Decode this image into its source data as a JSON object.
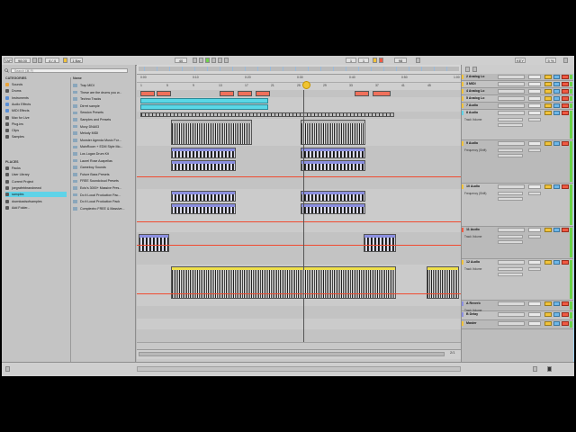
{
  "transport": {
    "tap_label": "TAP",
    "tempo": "98.00",
    "signature": "4 / 4",
    "metronome_label": "1 Bar",
    "position": "40",
    "loop_start": "1",
    "loop_end": "1",
    "loop_length": "98",
    "key_label": "KEY",
    "cpu": "5 %"
  },
  "browser": {
    "search_placeholder": "Search (⌘ F)",
    "categories_title": "CATEGORIES",
    "places_title": "PLACES",
    "categories": [
      {
        "label": "Sounds",
        "color": "#e8a33a"
      },
      {
        "label": "Drums",
        "color": "#5a5a5a"
      },
      {
        "label": "Instruments",
        "color": "#5a8fd6"
      },
      {
        "label": "Audio Effects",
        "color": "#5a8fd6"
      },
      {
        "label": "MIDI Effects",
        "color": "#5a8fd6"
      },
      {
        "label": "Max for Live",
        "color": "#5a5a5a"
      },
      {
        "label": "Plug-ins",
        "color": "#5a5a5a"
      },
      {
        "label": "Clips",
        "color": "#5a5a5a"
      },
      {
        "label": "Samples",
        "color": "#5a5a5a"
      }
    ],
    "places": [
      {
        "label": "Packs",
        "color": "#5a5a5a"
      },
      {
        "label": "User Library",
        "color": "#5a5a5a"
      },
      {
        "label": "Current Project",
        "color": "#5a5a5a"
      },
      {
        "label": "joegrafebbrandnewd",
        "color": "#5a5a5a"
      },
      {
        "label": "samples",
        "color": "#5a5a5a"
      },
      {
        "label": "downloadsofsamples",
        "color": "#5a5a5a"
      },
      {
        "label": "Add Folder...",
        "color": "#5a5a5a"
      }
    ],
    "files_title": "Name",
    "files": [
      "Trap MIDI",
      "These are the drums you w...",
      "Techno Tracks",
      "Dirrrrt sample",
      "Session Presets",
      "Samples and Presets",
      "Moxy DNA03",
      "Melody MIDI",
      "Monster Agenda Music For...",
      "MainRoom + EDM Style Mo...",
      "Los Logan Drum Kit",
      "Laurel Rose Acapellas",
      "Gameboy Sounds",
      "Future Bass Presets",
      "FREE Soundcloud Presets",
      "Ecto's 3000+ Massive Pres...",
      "Do it Local Production Pac...",
      "Do it Local Production Pack",
      "Complextro FREE & Massive..."
    ]
  },
  "mixer": {
    "tracks": [
      {
        "name": "2 Analog Lo",
        "color": "#f2c33a",
        "sub": "",
        "height": 8
      },
      {
        "name": "3 MIDI",
        "color": "#f2c33a",
        "sub": "",
        "height": 8
      },
      {
        "name": "4 Analog Lo",
        "color": "#f2c33a",
        "sub": "",
        "height": 8
      },
      {
        "name": "5 Analog Lo",
        "color": "#f2c33a",
        "sub": "",
        "height": 8
      },
      {
        "name": "7 Audio",
        "color": "#f2c33a",
        "sub": "",
        "height": 8
      },
      {
        "name": "8 Audio",
        "color": "#5fd3e8",
        "sub": "Track Volume",
        "height": 34
      },
      {
        "name": "9 Audio",
        "color": "#f2c33a",
        "sub": "Frequency (Shift)",
        "height": 48
      },
      {
        "name": "10 Audio",
        "color": "#f2c33a",
        "sub": "Frequency (Shift)",
        "height": 48
      },
      {
        "name": "11 Audio",
        "color": "#f05a43",
        "sub": "Track Volume",
        "height": 36
      },
      {
        "name": "12 Audio",
        "color": "#f2c33a",
        "sub": "Track Volume",
        "height": 46
      },
      {
        "name": "A Reverb",
        "color": "#8b8fe0",
        "sub": "Track Volume",
        "height": 12
      },
      {
        "name": "B Delay",
        "color": "#8b8fe0",
        "sub": "",
        "height": 10
      },
      {
        "name": "Master",
        "color": "#f2c33a",
        "sub": "",
        "height": 10
      }
    ],
    "master_fraction": "2/1"
  },
  "ruler": [
    "1",
    "5",
    "9",
    "13",
    "17",
    "21",
    "25",
    "29",
    "33",
    "37",
    "41",
    "45"
  ],
  "timebar": [
    "0:00",
    "0:10",
    "0:20",
    "0:30",
    "0:40",
    "0:50",
    "1:00"
  ],
  "clips": {
    "midi_label": "2 MIDI",
    "audio_label": "8 Audio",
    "drums_label": "Ride Loop"
  }
}
